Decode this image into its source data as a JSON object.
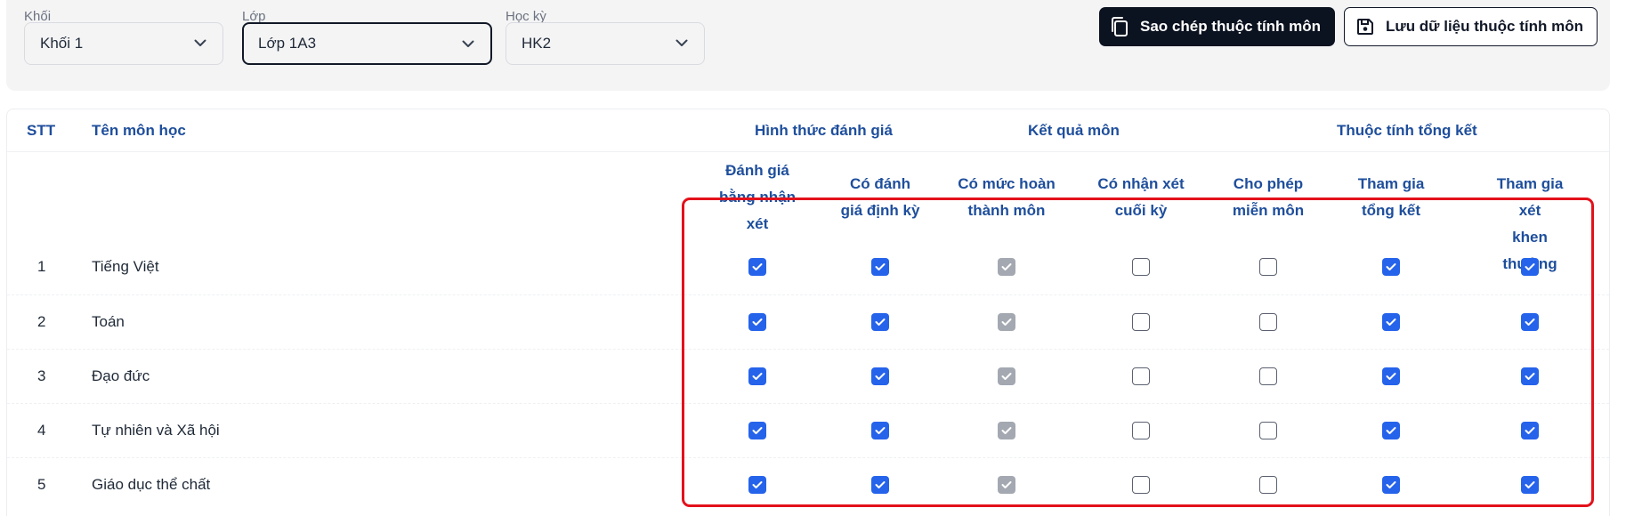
{
  "filters": {
    "grade": {
      "label": "Khối",
      "value": "Khối 1"
    },
    "class": {
      "label": "Lớp",
      "value": "Lớp 1A3"
    },
    "semester": {
      "label": "Học kỳ",
      "value": "HK2"
    }
  },
  "actions": {
    "copy_label": "Sao chép thuộc tính môn",
    "save_label": "Lưu dữ liệu thuộc tính môn"
  },
  "table": {
    "headers": {
      "stt": "STT",
      "subject": "Tên môn học",
      "group_assessment": "Hình thức đánh giá",
      "group_result": "Kết quả môn",
      "group_summary": "Thuộc tính tổng kết"
    },
    "columns": [
      {
        "l1": "Đánh giá",
        "l2": "bằng nhận",
        "l3": "xét"
      },
      {
        "l1": "Có đánh",
        "l2": "giá định kỳ"
      },
      {
        "l1": "Có mức hoàn",
        "l2": "thành môn"
      },
      {
        "l1": "Có nhận xét",
        "l2": "cuối kỳ"
      },
      {
        "l1": "Cho phép",
        "l2": "miễn môn"
      },
      {
        "l1": "Tham gia",
        "l2": "tổng kết"
      },
      {
        "l1": "Tham gia xét",
        "l2": "khen thưởng"
      }
    ],
    "rows": [
      {
        "stt": "1",
        "name": "Tiếng Việt",
        "checks": [
          "on",
          "on",
          "disabled",
          "off",
          "off",
          "on",
          "on"
        ]
      },
      {
        "stt": "2",
        "name": "Toán",
        "checks": [
          "on",
          "on",
          "disabled",
          "off",
          "off",
          "on",
          "on"
        ]
      },
      {
        "stt": "3",
        "name": "Đạo đức",
        "checks": [
          "on",
          "on",
          "disabled",
          "off",
          "off",
          "on",
          "on"
        ]
      },
      {
        "stt": "4",
        "name": "Tự nhiên và Xã hội",
        "checks": [
          "on",
          "on",
          "disabled",
          "off",
          "off",
          "on",
          "on"
        ]
      },
      {
        "stt": "5",
        "name": "Giáo dục thể chất",
        "checks": [
          "on",
          "on",
          "disabled",
          "off",
          "off",
          "on",
          "on"
        ]
      }
    ]
  },
  "colors": {
    "header_blue": "#1e4e9c",
    "checkbox_blue": "#2563eb",
    "highlight_red": "#e3111b"
  },
  "icons": {
    "copy": "copy-icon",
    "save": "floppy-disk-icon",
    "chevron": "chevron-down-icon",
    "check": "check-icon"
  }
}
